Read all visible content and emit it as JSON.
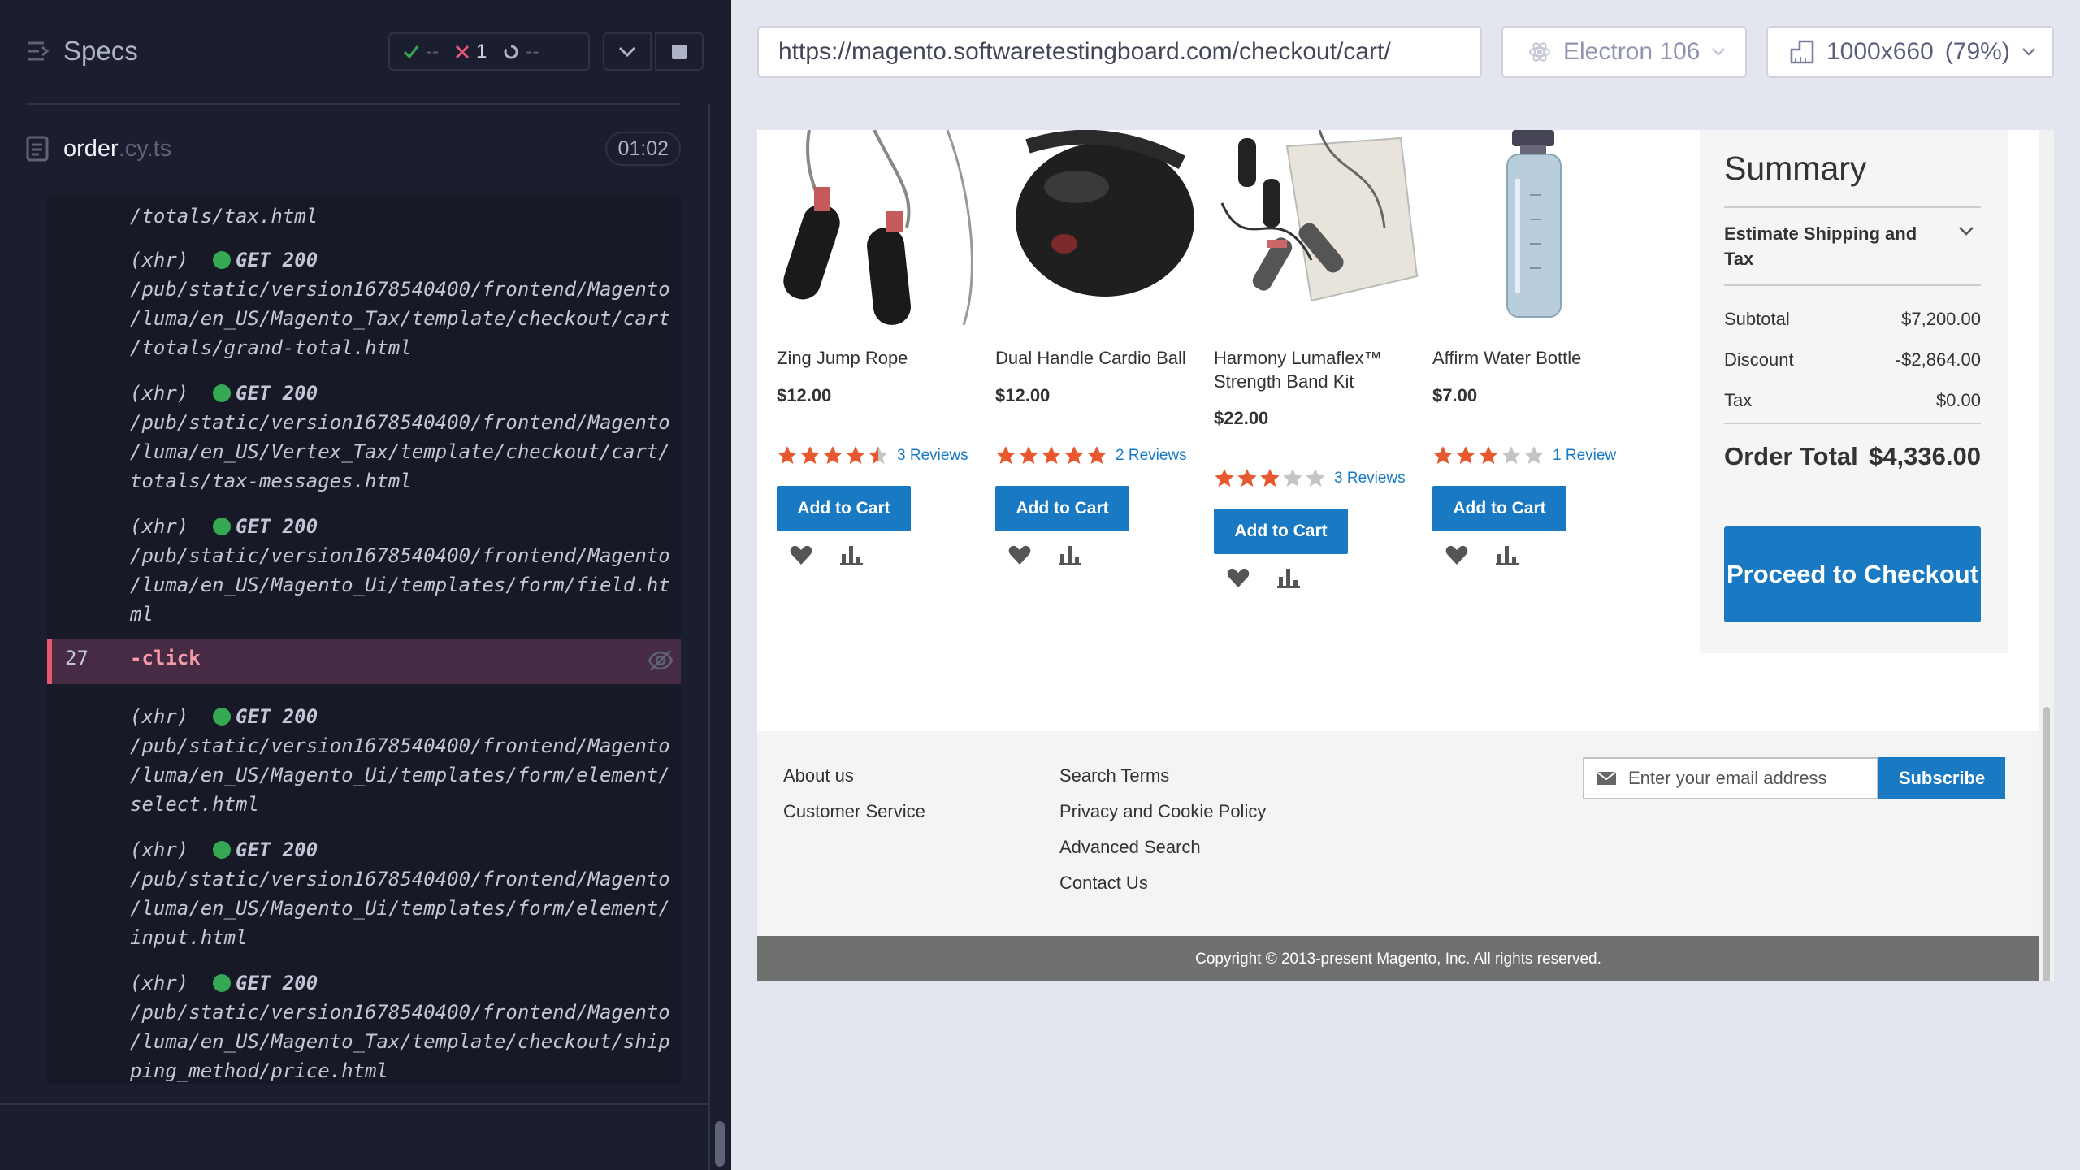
{
  "reporter": {
    "specs_label": "Specs",
    "stats": {
      "passed": "--",
      "failed": "1",
      "pending": "--"
    },
    "file": {
      "name": "order",
      "ext": ".cy.ts",
      "duration": "01:02"
    },
    "log": {
      "partial_line": "/totals/tax.html",
      "xhr_label": "(xhr)",
      "requests": [
        {
          "status": "GET 200",
          "lines": [
            "/pub/static/version1678540400/frontend/Magento",
            "/luma/en_US/Magento_Tax/template/checkout/cart",
            "/totals/grand-total.html"
          ]
        },
        {
          "status": "GET 200",
          "lines": [
            "/pub/static/version1678540400/frontend/Magento",
            "/luma/en_US/Vertex_Tax/template/checkout/cart/",
            "totals/tax-messages.html"
          ]
        },
        {
          "status": "GET 200",
          "lines": [
            "/pub/static/version1678540400/frontend/Magento",
            "/luma/en_US/Magento_Ui/templates/form/field.ht",
            "ml"
          ]
        },
        {
          "status": "GET 200",
          "lines": [
            "/pub/static/version1678540400/frontend/Magento",
            "/luma/en_US/Magento_Ui/templates/form/element/",
            "select.html"
          ]
        },
        {
          "status": "GET 200",
          "lines": [
            "/pub/static/version1678540400/frontend/Magento",
            "/luma/en_US/Magento_Ui/templates/form/element/",
            "input.html"
          ]
        },
        {
          "status": "GET 200",
          "lines": [
            "/pub/static/version1678540400/frontend/Magento",
            "/luma/en_US/Magento_Tax/template/checkout/ship",
            "ping_method/price.html"
          ]
        }
      ],
      "click": {
        "number": "27",
        "name": "-click"
      }
    }
  },
  "runner": {
    "url": "https://magento.softwaretestingboard.com/checkout/cart/",
    "browser": "Electron 106",
    "viewport": "1000x660",
    "zoom": "(79%)"
  },
  "products": [
    {
      "name": "Zing Jump Rope",
      "price": "$12.00",
      "rating": 4.5,
      "reviews": "3 Reviews",
      "add_label": "Add to Cart"
    },
    {
      "name": "Dual Handle Cardio Ball",
      "price": "$12.00",
      "rating": 5,
      "reviews": "2 Reviews",
      "add_label": "Add to Cart"
    },
    {
      "name": "Harmony Lumaflex™ Strength Band Kit",
      "price": "$22.00",
      "rating": 3,
      "reviews": "3 Reviews",
      "add_label": "Add to Cart"
    },
    {
      "name": "Affirm Water Bottle",
      "price": "$7.00",
      "rating": 3,
      "reviews": "1 Review",
      "add_label": "Add to Cart"
    }
  ],
  "summary": {
    "title": "Summary",
    "estimate": "Estimate Shipping and Tax",
    "subtotal_label": "Subtotal",
    "subtotal": "$7,200.00",
    "discount_label": "Discount",
    "discount": "-$2,864.00",
    "tax_label": "Tax",
    "tax": "$0.00",
    "total_label": "Order Total",
    "total": "$4,336.00",
    "checkout_label": "Proceed to Checkout"
  },
  "footer": {
    "col1": [
      "About us",
      "Customer Service"
    ],
    "col2": [
      "Search Terms",
      "Privacy and Cookie Policy",
      "Advanced Search",
      "Contact Us"
    ],
    "newsletter_placeholder": "Enter your email address",
    "subscribe_label": "Subscribe",
    "copyright": "Copyright © 2013-present Magento, Inc. All rights reserved."
  },
  "colors": {
    "accent": "#1979c3",
    "star": "#e8582f",
    "star_empty": "#c4c4c4",
    "success": "#34a853",
    "fail": "#e45770"
  }
}
